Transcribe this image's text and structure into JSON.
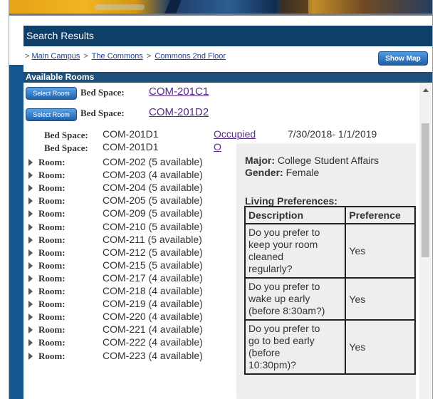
{
  "header": {
    "title": "Search Results"
  },
  "breadcrumb": {
    "prefix": ">",
    "items": [
      "Main Campus",
      "The Commons",
      "Commons 2nd Floor"
    ],
    "separator": ">"
  },
  "toolbar": {
    "show_map_label": "Show Map"
  },
  "available": {
    "title": "Available Rooms",
    "select_label": "Select Room",
    "bed_label": "Bed Space:",
    "bed_spaces": [
      "COM-201C1",
      "COM-201D2"
    ]
  },
  "occupied": {
    "rows": [
      {
        "label": "Bed Space:",
        "value": "COM-201D1",
        "link": "Occupied",
        "dates": "7/30/2018- 1/1/2019"
      },
      {
        "label": "Bed Space:",
        "value": "COM-201D1",
        "link": "O"
      }
    ]
  },
  "rooms": {
    "label": "Room:",
    "items": [
      "COM-202 (5 available)",
      "COM-203 (4 available)",
      "COM-204 (5 available)",
      "COM-205 (5 available)",
      "COM-209 (5 available)",
      "COM-210 (5 available)",
      "COM-211 (5 available)",
      "COM-212 (5 available)",
      "COM-215 (5 available)",
      "COM-217 (4 available)",
      "COM-218 (4 available)",
      "COM-219 (4 available)",
      "COM-220 (4 available)",
      "COM-221 (4 available)",
      "COM-222 (4 available)",
      "COM-223 (4 available)"
    ]
  },
  "tooltip": {
    "major_label": "Major:",
    "major_value": "College Student Affairs",
    "gender_label": "Gender:",
    "gender_value": "Female",
    "living_title": "Living Preferences:",
    "headers": [
      "Description",
      "Preference"
    ],
    "rows": [
      {
        "desc": [
          "Do you prefer to",
          "keep your room",
          "cleaned",
          "regularly?"
        ],
        "pref": "Yes"
      },
      {
        "desc": [
          "Do you prefer to",
          "wake up early",
          "(before 8:30am?)"
        ],
        "pref": "Yes"
      },
      {
        "desc": [
          "Do you prefer to",
          "go to bed early",
          "(before",
          "10:30pm)?"
        ],
        "pref": "Yes"
      }
    ]
  },
  "colors": {
    "header_bg": "#0e3f69",
    "link": "#5a2a8a",
    "button": "#1f62ab"
  }
}
